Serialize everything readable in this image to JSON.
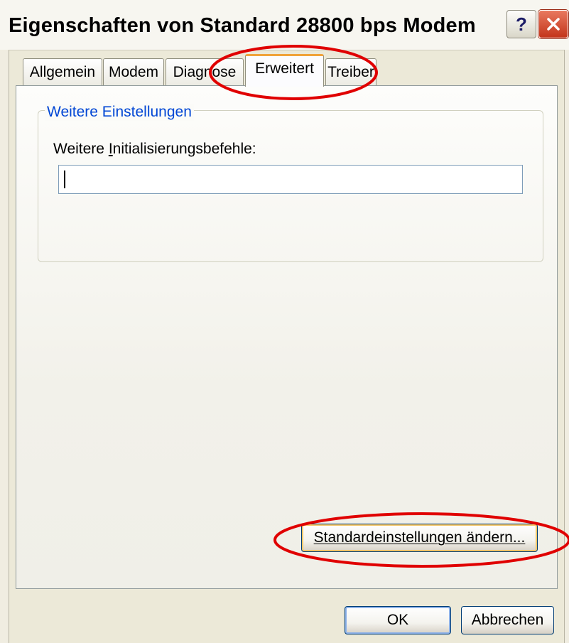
{
  "window": {
    "title": "Eigenschaften von Standard 28800 bps Modem",
    "help_glyph": "?",
    "close_icon": "close-icon"
  },
  "tabs": [
    {
      "label": "Allgemein",
      "active": false
    },
    {
      "label": "Modem",
      "active": false
    },
    {
      "label": "Diagnose",
      "active": false
    },
    {
      "label": "Erweitert",
      "active": true
    },
    {
      "label": "Treiber",
      "active": false
    }
  ],
  "group": {
    "legend": "Weitere Einstellungen",
    "field_label_before": "Weitere ",
    "field_label_access": "I",
    "field_label_after": "nitialisierungsbefehle:",
    "field_value": ""
  },
  "buttons": {
    "defaults": "Standardeinstellungen ändern...",
    "ok": "OK",
    "cancel": "Abbrechen"
  },
  "colors": {
    "dialog_bg": "#ece9d8",
    "active_tab_accent": "#f0a33a",
    "groupbox_legend": "#0046d5",
    "annotation_red": "#e00000"
  }
}
